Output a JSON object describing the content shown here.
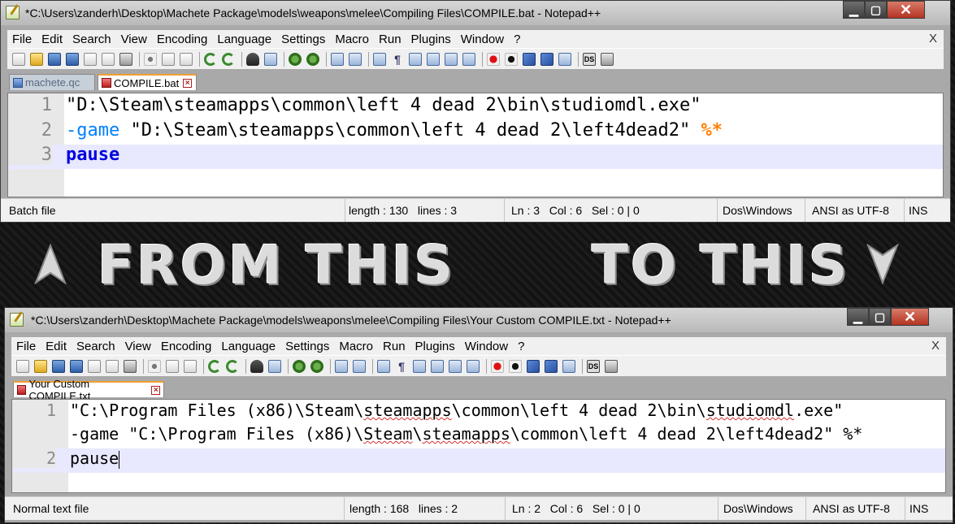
{
  "banner": {
    "left_text": "FROM THIS",
    "right_text": "TO THIS",
    "left_arrow_icon": "up-arrow-icon",
    "right_arrow_icon": "down-arrow-icon"
  },
  "menu_labels": [
    "File",
    "Edit",
    "Search",
    "View",
    "Encoding",
    "Language",
    "Settings",
    "Macro",
    "Run",
    "Plugins",
    "Window",
    "?"
  ],
  "menu_close": "X",
  "window_buttons": {
    "minimize": "▁",
    "maximize": "▢",
    "close": "✕"
  },
  "top_window": {
    "title": "*C:\\Users\\zanderh\\Desktop\\Machete Package\\models\\weapons\\melee\\Compiling Files\\COMPILE.bat - Notepad++",
    "tabs": [
      {
        "label": "machete.qc",
        "active": false
      },
      {
        "label": "COMPILE.bat",
        "active": true
      }
    ],
    "lines": [
      {
        "num": "1",
        "text": "\"D:\\Steam\\steamapps\\common\\left 4 dead 2\\bin\\studiomdl.exe\""
      },
      {
        "num": "2",
        "parts": [
          "-game",
          " \"D:\\Steam\\steamapps\\common\\left 4 dead 2\\left4dead2\" ",
          "%*"
        ]
      },
      {
        "num": "3",
        "text": "pause"
      }
    ],
    "status": {
      "filetype": "Batch file",
      "length": "length : 130",
      "lines": "lines : 3",
      "ln": "Ln : 3",
      "col": "Col : 6",
      "sel": "Sel : 0 | 0",
      "eol": "Dos\\Windows",
      "encoding": "ANSI as UTF-8",
      "mode": "INS"
    }
  },
  "bottom_window": {
    "title": "*C:\\Users\\zanderh\\Desktop\\Machete Package\\models\\weapons\\melee\\Compiling Files\\Your Custom COMPILE.txt - Notepad++",
    "tabs": [
      {
        "label": "Your Custom COMPILE.txt",
        "active": true
      }
    ],
    "lines": [
      {
        "num": "1",
        "parts": [
          "\"C:\\Program Files (x86)\\Steam\\",
          "steamapps",
          "\\common\\left 4 dead 2\\bin\\",
          "studiomdl",
          ".exe\""
        ]
      },
      {
        "num": "",
        "parts": [
          "-game \"C:\\Program Files (x86)\\",
          "Steam",
          "\\",
          "steamapps",
          "\\common\\left 4 dead 2\\left4dead2\" %*"
        ]
      },
      {
        "num": "2",
        "text": "pause"
      }
    ],
    "status": {
      "filetype": "Normal text file",
      "length": "length : 168",
      "lines": "lines : 2",
      "ln": "Ln : 2",
      "col": "Col : 6",
      "sel": "Sel : 0 | 0",
      "eol": "Dos\\Windows",
      "encoding": "ANSI as UTF-8",
      "mode": "INS"
    }
  }
}
